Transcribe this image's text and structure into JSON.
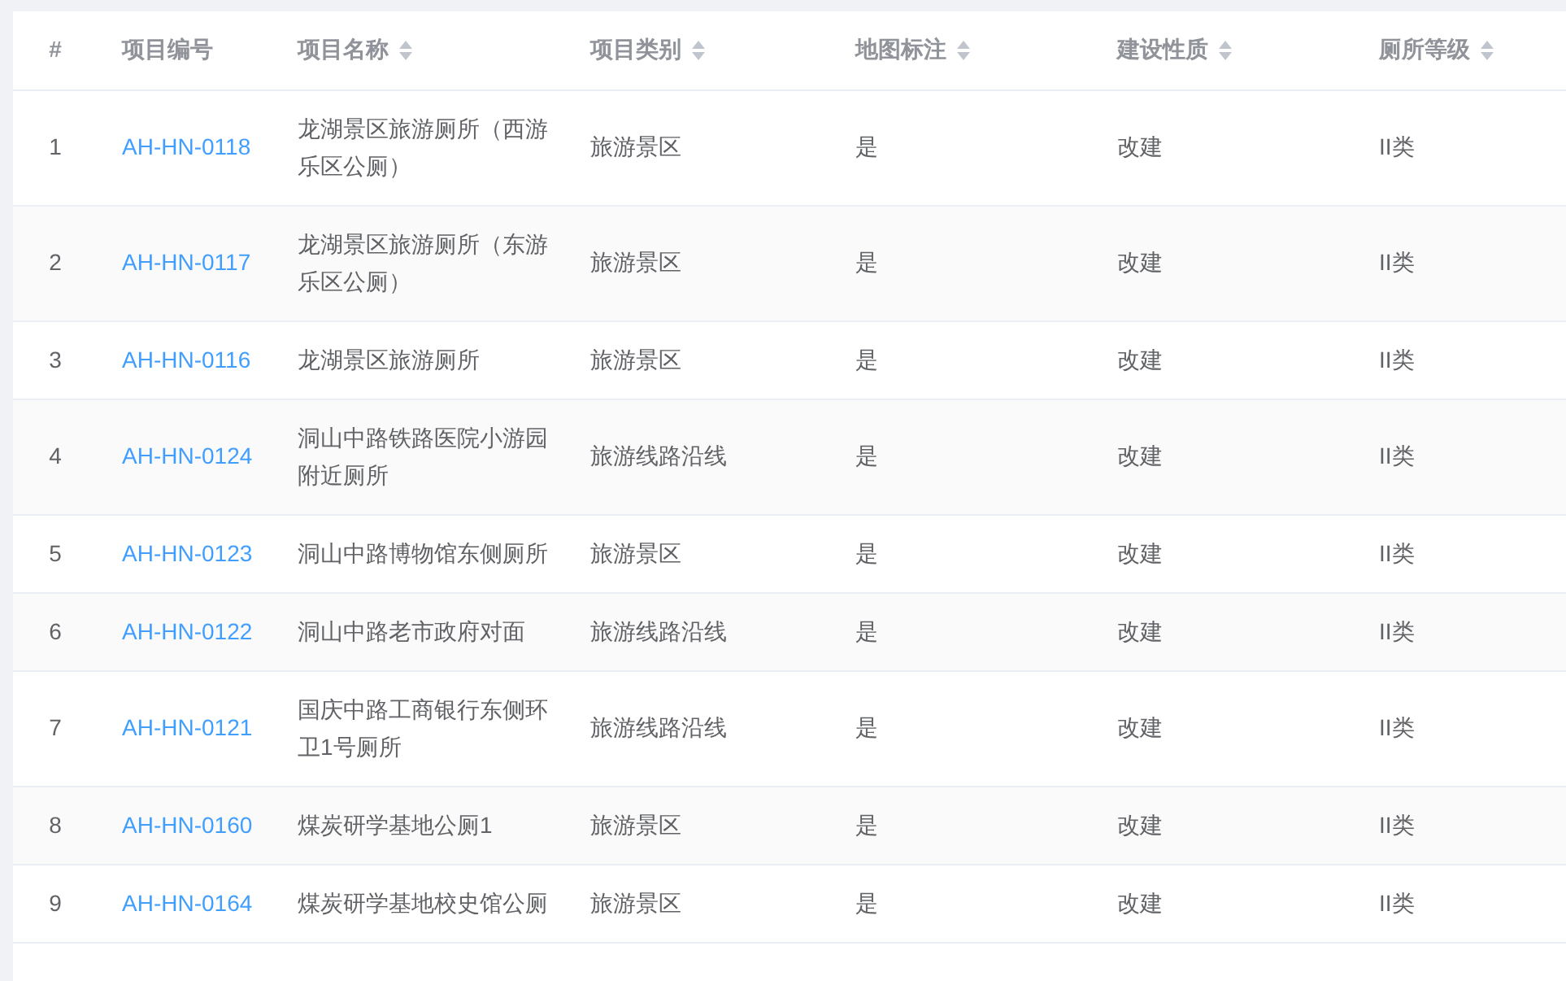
{
  "table": {
    "columns": [
      {
        "label": "#",
        "sortable": false,
        "kind": "index"
      },
      {
        "label": "项目编号",
        "sortable": false,
        "kind": "link"
      },
      {
        "label": "项目名称",
        "sortable": true,
        "kind": "text"
      },
      {
        "label": "项目类别",
        "sortable": true,
        "kind": "text"
      },
      {
        "label": "地图标注",
        "sortable": true,
        "kind": "text"
      },
      {
        "label": "建设性质",
        "sortable": true,
        "kind": "text"
      },
      {
        "label": "厕所等级",
        "sortable": true,
        "kind": "text"
      }
    ],
    "rows": [
      [
        "1",
        "AH-HN-0118",
        "龙湖景区旅游厕所（西游乐区公厕）",
        "旅游景区",
        "是",
        "改建",
        "II类"
      ],
      [
        "2",
        "AH-HN-0117",
        "龙湖景区旅游厕所（东游乐区公厕）",
        "旅游景区",
        "是",
        "改建",
        "II类"
      ],
      [
        "3",
        "AH-HN-0116",
        "龙湖景区旅游厕所",
        "旅游景区",
        "是",
        "改建",
        "II类"
      ],
      [
        "4",
        "AH-HN-0124",
        "洞山中路铁路医院小游园附近厕所",
        "旅游线路沿线",
        "是",
        "改建",
        "II类"
      ],
      [
        "5",
        "AH-HN-0123",
        "洞山中路博物馆东侧厕所",
        "旅游景区",
        "是",
        "改建",
        "II类"
      ],
      [
        "6",
        "AH-HN-0122",
        "洞山中路老市政府对面",
        "旅游线路沿线",
        "是",
        "改建",
        "II类"
      ],
      [
        "7",
        "AH-HN-0121",
        "国庆中路工商银行东侧环卫1号厕所",
        "旅游线路沿线",
        "是",
        "改建",
        "II类"
      ],
      [
        "8",
        "AH-HN-0160",
        "煤炭研学基地公厕1",
        "旅游景区",
        "是",
        "改建",
        "II类"
      ],
      [
        "9",
        "AH-HN-0164",
        "煤炭研学基地校史馆公厕",
        "旅游景区",
        "是",
        "改建",
        "II类"
      ]
    ]
  }
}
